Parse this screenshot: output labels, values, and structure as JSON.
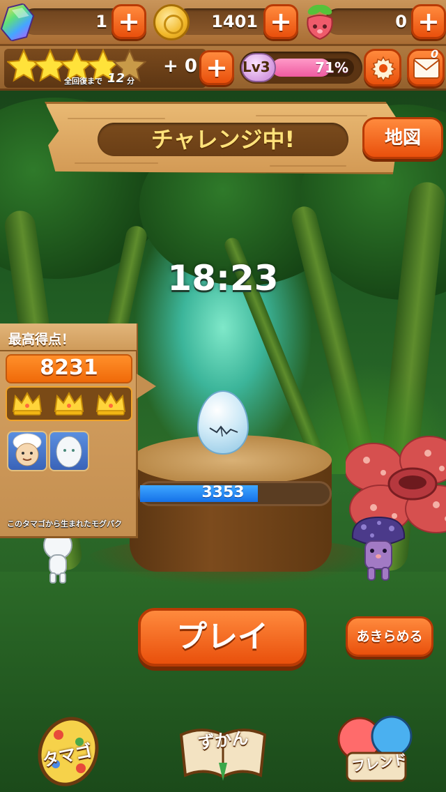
{
  "resources": {
    "gems": "1",
    "coins": "1401",
    "berries": "0"
  },
  "stamina": {
    "stars_filled": 4,
    "stars_total": 5,
    "recover_prefix": "全回復まで",
    "recover_minutes": "12",
    "recover_unit": "分",
    "bonus": "+ 0"
  },
  "level": {
    "label": "Lv3",
    "progress_text": "71%",
    "progress_fraction": 0.71
  },
  "mail": {
    "unread_count": "0"
  },
  "icons": {
    "gem": "rainbow-gem-icon",
    "coin": "gold-coin-icon",
    "berry": "berry-icon",
    "settings": "gear-icon",
    "mail": "envelope-icon",
    "plus": "+"
  },
  "sign": {
    "title": "チャレンジ中!",
    "map_button": "地図"
  },
  "timer": "18:23",
  "egg": {
    "hp_value": "3353",
    "hp_fraction": 0.62
  },
  "high_score": {
    "title": "最高得点！",
    "score": "8231",
    "crowns": 3,
    "born_caption": "このタマゴから生まれたモグパク"
  },
  "actions": {
    "play": "プレイ",
    "give_up": "あきらめる"
  },
  "nav": {
    "egg": "タマゴ",
    "zukan": "ずかん",
    "friend": "フレンド"
  },
  "colors": {
    "accent_orange": "#e9500c",
    "wood": "#c48f50",
    "level_pink": "#ee5aa0",
    "hp_blue": "#1571e8",
    "sign_text": "#ffe27a"
  }
}
